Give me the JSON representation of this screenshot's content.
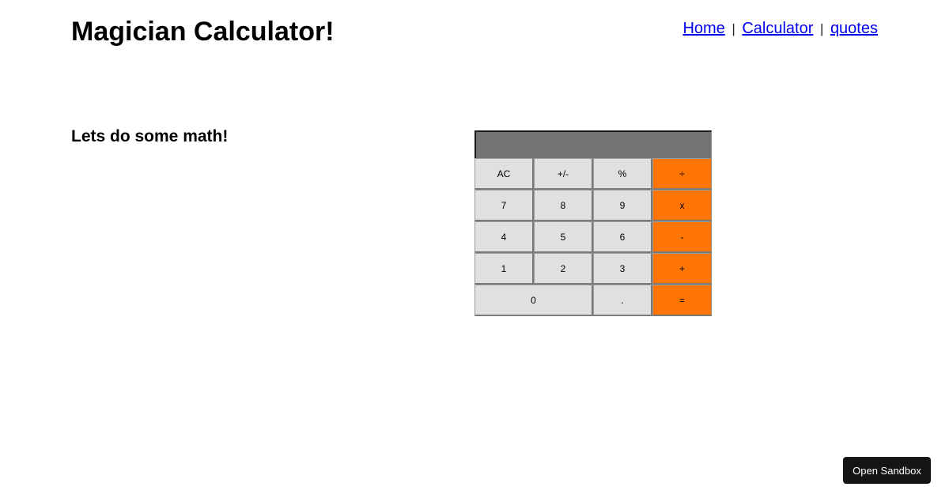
{
  "header": {
    "title": "Magician Calculator!",
    "nav": {
      "home": "Home",
      "calculator": "Calculator",
      "quotes": "quotes",
      "separator": "|"
    }
  },
  "main": {
    "intro": "Lets do some math!"
  },
  "calculator": {
    "display_value": "",
    "rows": [
      [
        "AC",
        "+/-",
        "%",
        "÷"
      ],
      [
        "7",
        "8",
        "9",
        "x"
      ],
      [
        "4",
        "5",
        "6",
        "-"
      ],
      [
        "1",
        "2",
        "3",
        "+"
      ],
      [
        "0",
        ".",
        "="
      ]
    ],
    "colors": {
      "display": "#737373",
      "key": "#e0e0e0",
      "operator": "#ff7504"
    }
  },
  "footer": {
    "sandbox_button": "Open Sandbox"
  }
}
